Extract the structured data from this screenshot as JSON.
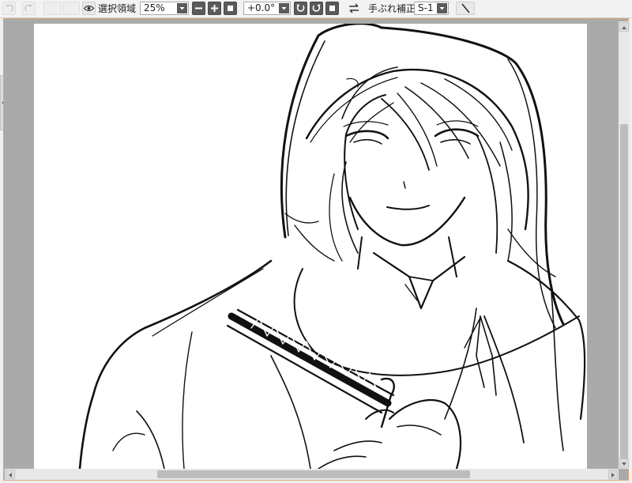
{
  "toolbar": {
    "undo_icon": "undo-icon",
    "redo_icon": "redo-icon",
    "selection_label": "選択領域",
    "zoom": {
      "value": "25%"
    },
    "zoom_out_icon": "minus-icon",
    "zoom_in_icon": "plus-icon",
    "rotation": {
      "value": "+0.0°"
    },
    "stabilizer_label": "手ぶれ補正",
    "stabilizer": {
      "value": "S-1"
    },
    "pen_icon": "pen-icon"
  },
  "canvas": {
    "content": "hooded-figure-sketch",
    "background": "#ffffff"
  },
  "colors": {
    "frame_border": "#d9a57a",
    "workspace": "#aaaaaa",
    "dark_button": "#5a5a5a"
  }
}
